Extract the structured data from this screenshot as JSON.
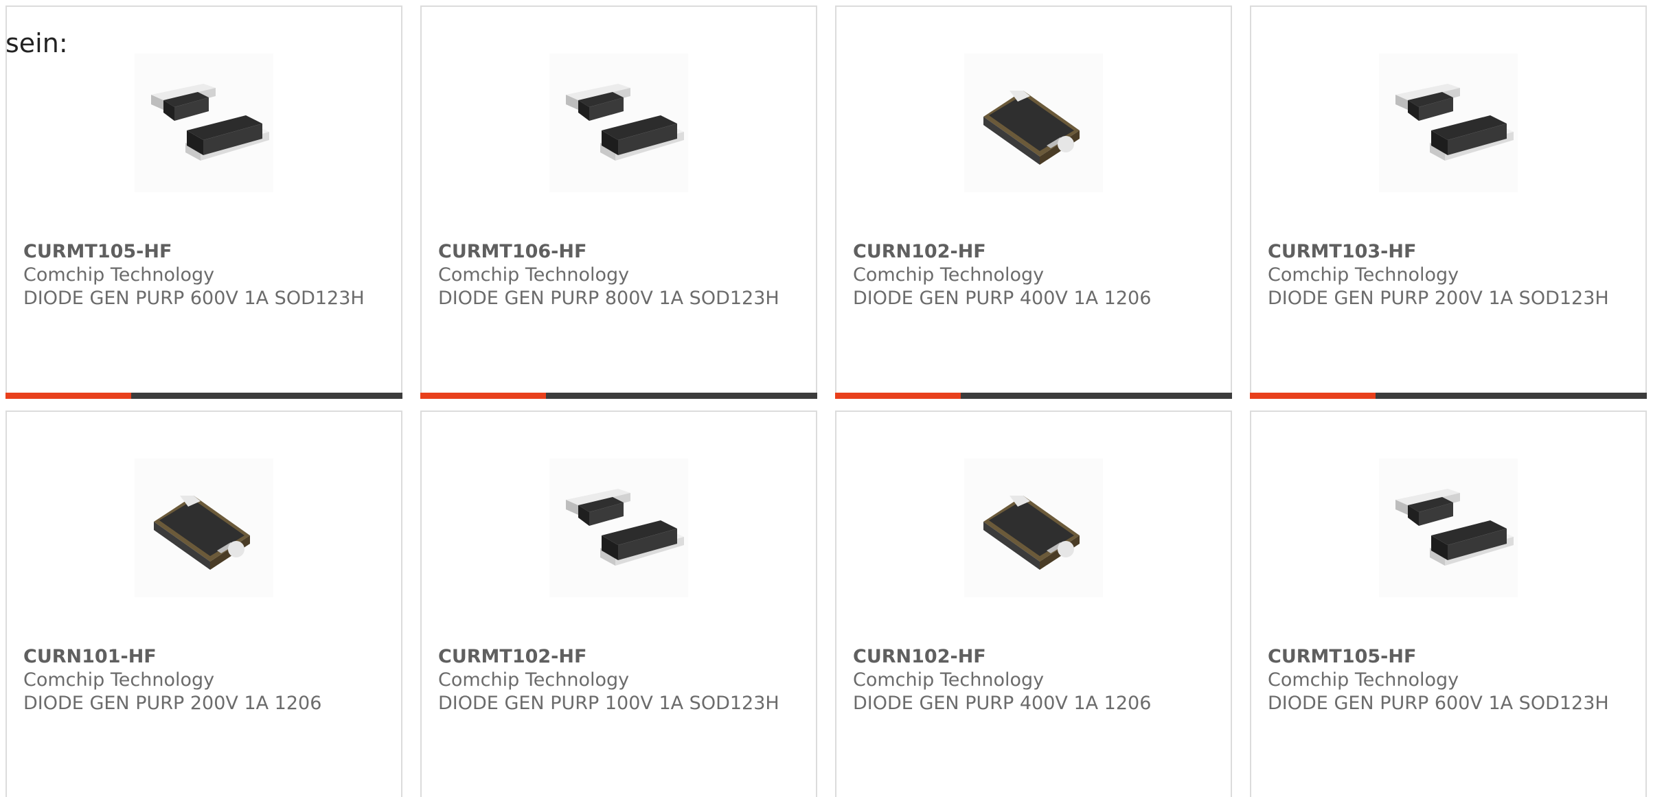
{
  "intro_text": "sein:",
  "colors": {
    "accent": "#e8401c",
    "bar": "#3c3c3c",
    "title": "#5f5f5f",
    "text": "#6b6b6b",
    "border": "#dcdcdc"
  },
  "products": [
    {
      "part": "CURMT105-HF",
      "maker": "Comchip Technology",
      "desc": "DIODE GEN PURP 600V 1A SOD123H",
      "image": "sod123h-diode-image"
    },
    {
      "part": "CURMT106-HF",
      "maker": "Comchip Technology",
      "desc": "DIODE GEN PURP 800V 1A SOD123H",
      "image": "sod123h-diode-image"
    },
    {
      "part": "CURN102-HF",
      "maker": "Comchip Technology",
      "desc": "DIODE GEN PURP 400V 1A 1206",
      "image": "1206-diode-image"
    },
    {
      "part": "CURMT103-HF",
      "maker": "Comchip Technology",
      "desc": "DIODE GEN PURP 200V 1A SOD123H",
      "image": "sod123h-diode-image"
    },
    {
      "part": "CURN101-HF",
      "maker": "Comchip Technology",
      "desc": "DIODE GEN PURP 200V 1A 1206",
      "image": "1206-diode-image"
    },
    {
      "part": "CURMT102-HF",
      "maker": "Comchip Technology",
      "desc": "DIODE GEN PURP 100V 1A SOD123H",
      "image": "sod123h-diode-image"
    },
    {
      "part": "CURN102-HF",
      "maker": "Comchip Technology",
      "desc": "DIODE GEN PURP 400V 1A 1206",
      "image": "1206-diode-image"
    },
    {
      "part": "CURMT105-HF",
      "maker": "Comchip Technology",
      "desc": "DIODE GEN PURP 600V 1A SOD123H",
      "image": "sod123h-diode-image"
    }
  ]
}
